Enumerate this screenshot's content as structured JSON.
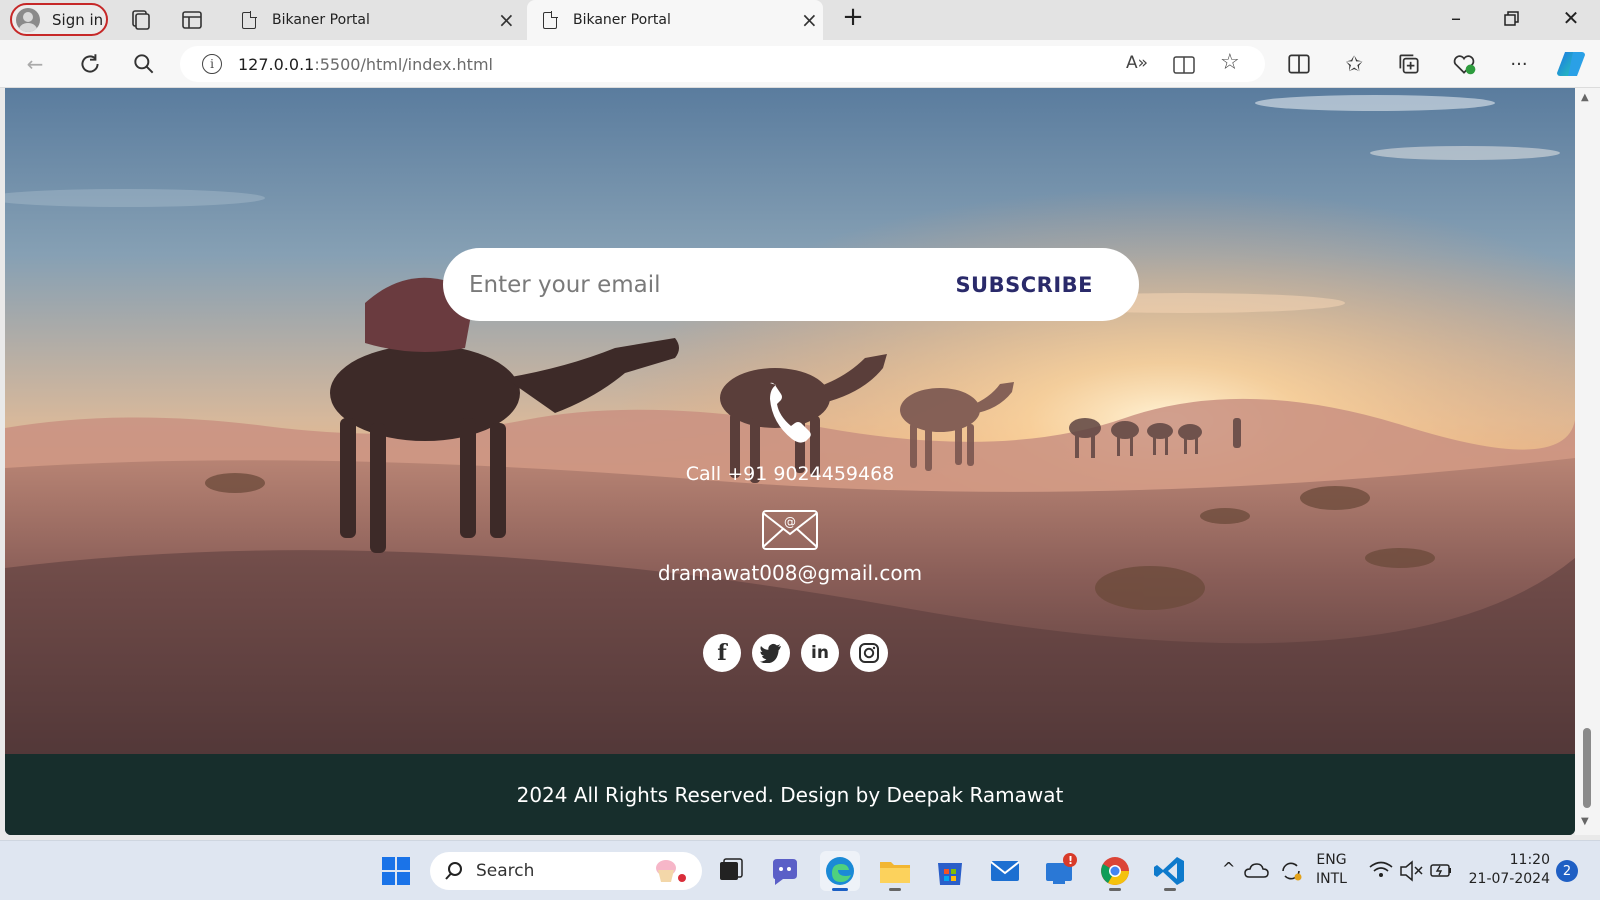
{
  "browser": {
    "sign_in_label": "Sign in",
    "tabs": [
      {
        "title": "Bikaner Portal",
        "active": false
      },
      {
        "title": "Bikaner Portal",
        "active": true
      }
    ],
    "address": {
      "host": "127.0.0.1",
      "rest": ":5500/html/index.html"
    }
  },
  "page": {
    "subscribe": {
      "placeholder": "Enter your email",
      "button_label": "SUBSCRIBE"
    },
    "contact": {
      "phone_text": "Call +91 9024459468",
      "email_text": "dramawat008@gmail.com"
    },
    "socials": [
      {
        "icon": "facebook-icon",
        "glyph": "f"
      },
      {
        "icon": "twitter-icon",
        "glyph": "t"
      },
      {
        "icon": "linkedin-icon",
        "glyph": "in"
      },
      {
        "icon": "instagram-icon",
        "glyph": "◎"
      }
    ],
    "footer_text": "2024 All Rights Reserved. Design by Deepak Ramawat"
  },
  "taskbar": {
    "search_label": "Search",
    "language": {
      "line1": "ENG",
      "line2": "INTL"
    },
    "clock": {
      "time": "11:20",
      "date": "21-07-2024"
    },
    "notification_count": "2"
  },
  "colors": {
    "footer_bg": "#172e2c",
    "subscribe_text": "#2a2a6a",
    "signin_border": "#c62828"
  }
}
